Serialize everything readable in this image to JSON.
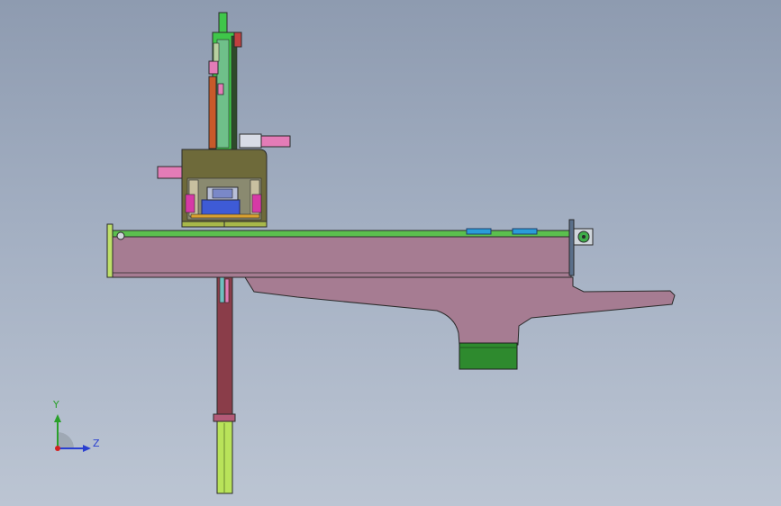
{
  "viewport": {
    "background_top": "#8e9bb0",
    "background_bottom": "#bcc5d3"
  },
  "colors": {
    "base_beam": "#a67c92",
    "mount_bracket": "#a67c92",
    "guide_rail": "#5bbf4e",
    "carriage_block": "#6e6a3a",
    "carriage_rail": "#a8b84a",
    "motor_body": "#3e5bd6",
    "motor_cap": "#b8bfd8",
    "vertical_column_upper": "#3fc64a",
    "vertical_column_lower": "#8a3d49",
    "lower_tip": "#b9e35a",
    "cylinder": "#e37cb7",
    "sensor_strip": "#2a9cd8",
    "foot_block": "#2e8a2e",
    "end_cap": "#bfe06a",
    "axis_y": "#2aa02a",
    "axis_z": "#2a3fd0",
    "axis_origin": "#d42020"
  },
  "triad": {
    "y_label": "Y",
    "z_label": "Z"
  }
}
